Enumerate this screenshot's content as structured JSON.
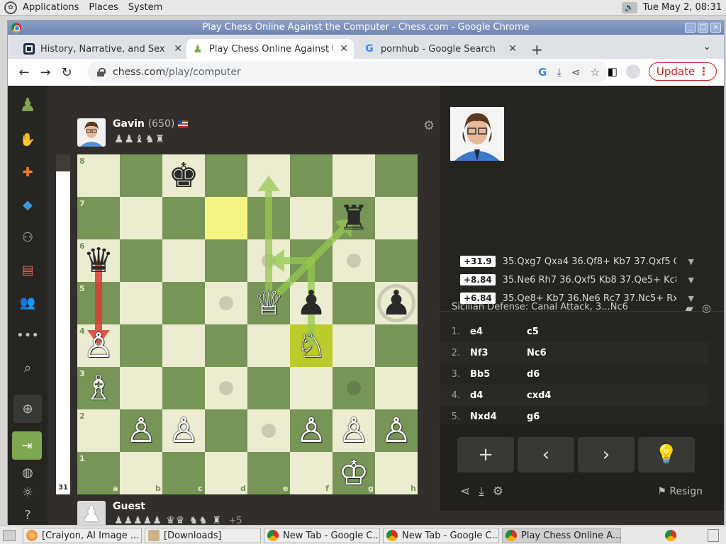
{
  "gnome_panel": {
    "menus": [
      "Applications",
      "Places",
      "System"
    ],
    "clock": "Tue May  2, 08:31"
  },
  "window": {
    "title": "Play Chess Online Against the Computer - Chess.com - Google Chrome"
  },
  "tabs": [
    {
      "title": "History, Narrative, and Sexual",
      "icon": "square-logo-icon"
    },
    {
      "title": "Play Chess Online Against the",
      "icon": "chess-pawn-icon"
    },
    {
      "title": "pornhub - Google Search",
      "icon": "google-icon"
    }
  ],
  "toolbar": {
    "url_host": "chess.com",
    "url_path": "/play/computer",
    "update_label": "Update"
  },
  "players": {
    "top": {
      "name": "Gavin",
      "rating": "(650)",
      "captured": "♟♟♝♞♜"
    },
    "bottom": {
      "name": "Guest",
      "captured": "♟♟♟♟♟ ♛♛ ♞♞ ♜",
      "advantage": "+5"
    }
  },
  "eval": {
    "value": "31"
  },
  "board": {
    "files": [
      "a",
      "b",
      "c",
      "d",
      "e",
      "f",
      "g",
      "h"
    ],
    "ranks": [
      "8",
      "7",
      "6",
      "5",
      "4",
      "3",
      "2",
      "1"
    ],
    "pieces": [
      {
        "sq": "c8",
        "glyph": "♚",
        "color": "b"
      },
      {
        "sq": "g7",
        "glyph": "♜",
        "color": "b"
      },
      {
        "sq": "a6",
        "glyph": "♛",
        "color": "b"
      },
      {
        "sq": "e5",
        "glyph": "♕",
        "color": "w"
      },
      {
        "sq": "f5",
        "glyph": "♟",
        "color": "b"
      },
      {
        "sq": "h5",
        "glyph": "♟",
        "color": "b"
      },
      {
        "sq": "a4",
        "glyph": "♙",
        "color": "w"
      },
      {
        "sq": "f4",
        "glyph": "♘",
        "color": "w"
      },
      {
        "sq": "a3",
        "glyph": "♗",
        "color": "w"
      },
      {
        "sq": "b2",
        "glyph": "♙",
        "color": "w"
      },
      {
        "sq": "c2",
        "glyph": "♙",
        "color": "w"
      },
      {
        "sq": "f2",
        "glyph": "♙",
        "color": "w"
      },
      {
        "sq": "g2",
        "glyph": "♙",
        "color": "w"
      },
      {
        "sq": "h2",
        "glyph": "♙",
        "color": "w"
      },
      {
        "sq": "g1",
        "glyph": "♔",
        "color": "w"
      }
    ],
    "highlight_last_move": [
      "d7"
    ],
    "highlight_selected": [
      "f4"
    ],
    "move_dots": [
      "e6",
      "g6",
      "d5",
      "d3",
      "g3",
      "e2"
    ],
    "capture_rings": [
      "h5"
    ],
    "colors": {
      "light": "#ebecd0",
      "dark": "#779556",
      "last_move": "#f5f682",
      "selected": "#bbcb2b"
    }
  },
  "analysis": {
    "lines": [
      {
        "eval": "+31.9",
        "moves": "35.Qxg7 Qxa4 36.Qf8+ Kb7 37.Qxf5 Qc..."
      },
      {
        "eval": "+8.84",
        "moves": "35.Ne6 Rh7 36.Qxf5 Kb8 37.Qe5+ Kc8 ..."
      },
      {
        "eval": "+6.84",
        "moves": "35.Qe8+ Kb7 36.Ne6 Rc7 37.Nc5+ Rxc..."
      }
    ],
    "opening": "Sicilian Defense: Canal Attack, 3...Nc6"
  },
  "moves": [
    {
      "no": "1.",
      "white": "e4",
      "black": "c5"
    },
    {
      "no": "2.",
      "white": "Nf3",
      "black": "Nc6"
    },
    {
      "no": "3.",
      "white": "Bb5",
      "black": "d6"
    },
    {
      "no": "4.",
      "white": "d4",
      "black": "cxd4"
    },
    {
      "no": "5.",
      "white": "Nxd4",
      "black": "g6"
    }
  ],
  "controls": {
    "resign_label": "Resign"
  },
  "taskbar": [
    {
      "label": "[Craiyon, AI Image ...",
      "icon": "firefox-icon"
    },
    {
      "label": "[Downloads]",
      "icon": "folder-icon"
    },
    {
      "label": "New Tab - Google C...",
      "icon": "chrome-icon"
    },
    {
      "label": "New Tab - Google C...",
      "icon": "chrome-icon"
    },
    {
      "label": "Play Chess Online A...",
      "icon": "chrome-icon"
    }
  ]
}
